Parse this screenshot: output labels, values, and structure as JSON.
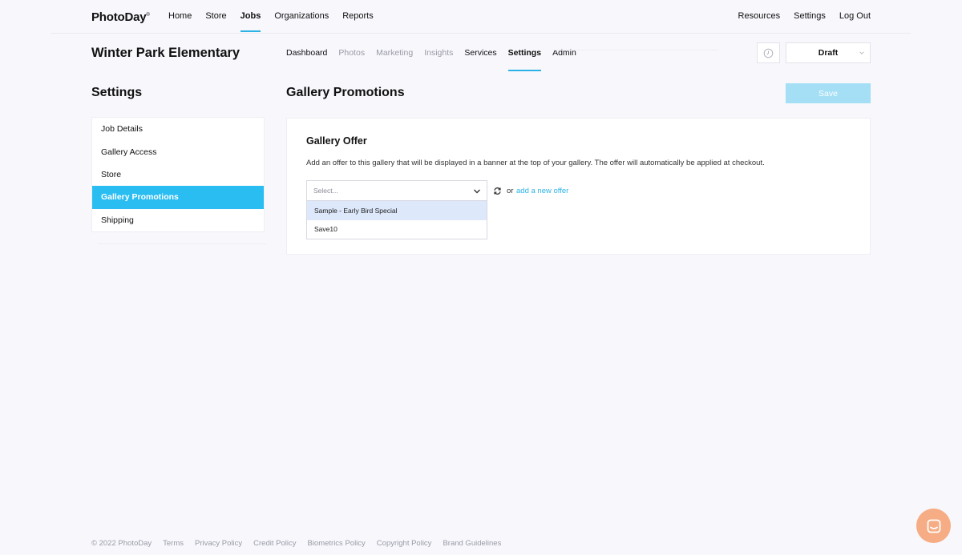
{
  "brand": {
    "logo": "PhotoDay",
    "logo_mark": "®"
  },
  "topnav": {
    "left": [
      {
        "label": "Home"
      },
      {
        "label": "Store"
      },
      {
        "label": "Jobs"
      },
      {
        "label": "Organizations"
      },
      {
        "label": "Reports"
      }
    ],
    "active": "Jobs",
    "right": [
      {
        "label": "Resources"
      },
      {
        "label": "Settings"
      },
      {
        "label": "Log Out"
      }
    ]
  },
  "job": {
    "title": "Winter Park Elementary",
    "subnav": [
      {
        "label": "Dashboard",
        "state": "enabled"
      },
      {
        "label": "Photos",
        "state": "disabled"
      },
      {
        "label": "Marketing",
        "state": "disabled"
      },
      {
        "label": "Insights",
        "state": "disabled"
      },
      {
        "label": "Services",
        "state": "enabled"
      },
      {
        "label": "Settings",
        "state": "active"
      },
      {
        "label": "Admin",
        "state": "enabled"
      }
    ],
    "status": "Draft",
    "clock_icon": "clock-icon"
  },
  "settings": {
    "title": "Settings",
    "items": [
      {
        "label": "Job Details"
      },
      {
        "label": "Gallery Access"
      },
      {
        "label": "Store"
      },
      {
        "label": "Gallery Promotions"
      },
      {
        "label": "Shipping"
      }
    ],
    "active": "Gallery Promotions"
  },
  "main": {
    "title": "Gallery Promotions",
    "save_label": "Save",
    "card": {
      "title": "Gallery Offer",
      "description": "Add an offer to this gallery that will be displayed in a banner at the top of your gallery. The offer will automatically be applied at checkout.",
      "select_placeholder": "Select...",
      "options": [
        {
          "label": "Sample - Early Bird Special"
        },
        {
          "label": "Save10"
        }
      ],
      "or_text": "or",
      "add_link": "add a new offer"
    }
  },
  "footer": {
    "copyright": "© 2022 PhotoDay",
    "links": [
      {
        "label": "Terms"
      },
      {
        "label": "Privacy Policy"
      },
      {
        "label": "Credit Policy"
      },
      {
        "label": "Biometrics Policy"
      },
      {
        "label": "Copyright Policy"
      },
      {
        "label": "Brand Guidelines"
      }
    ]
  },
  "colors": {
    "accent": "#29bdf2",
    "link": "#2bb3e6",
    "save_disabled": "#a4dff5",
    "chat": "#f6ac84",
    "background": "#f7f7fc"
  }
}
